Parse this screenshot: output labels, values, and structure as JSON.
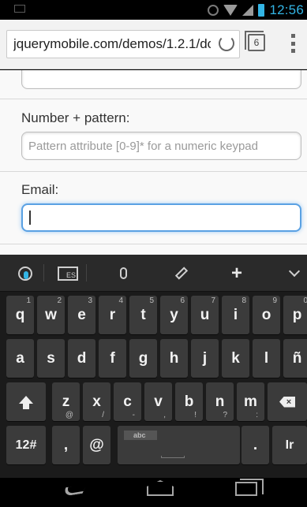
{
  "status_bar": {
    "time": "12:56"
  },
  "browser": {
    "url": "jquerymobile.com/demos/1.2.1/doc",
    "tab_count": "6"
  },
  "form": {
    "number_label": "Number + pattern:",
    "number_placeholder": "Pattern attribute [0-9]* for a numeric keypad",
    "number_value": "",
    "email_label": "Email:",
    "email_value": ""
  },
  "keyboard": {
    "layout_label": "ES",
    "space_label": "abc",
    "row1": [
      {
        "k": "q",
        "n": "1"
      },
      {
        "k": "w",
        "n": "2"
      },
      {
        "k": "e",
        "n": "3"
      },
      {
        "k": "r",
        "n": "4"
      },
      {
        "k": "t",
        "n": "5"
      },
      {
        "k": "y",
        "n": "6"
      },
      {
        "k": "u",
        "n": "7"
      },
      {
        "k": "i",
        "n": "8"
      },
      {
        "k": "o",
        "n": "9"
      },
      {
        "k": "p",
        "n": "0"
      }
    ],
    "row2": [
      "a",
      "s",
      "d",
      "f",
      "g",
      "h",
      "j",
      "k",
      "l",
      "ñ"
    ],
    "row3": [
      {
        "k": "z",
        "s": "@"
      },
      {
        "k": "x",
        "s": "/"
      },
      {
        "k": "c",
        "s": "-"
      },
      {
        "k": "v",
        "s": ","
      },
      {
        "k": "b",
        "s": "!"
      },
      {
        "k": "n",
        "s": "?"
      },
      {
        "k": "m",
        "s": ":"
      }
    ],
    "row4": {
      "sym": "12#",
      "comma": ",",
      "at": "@",
      "period": ".",
      "enter": "Ir"
    }
  }
}
